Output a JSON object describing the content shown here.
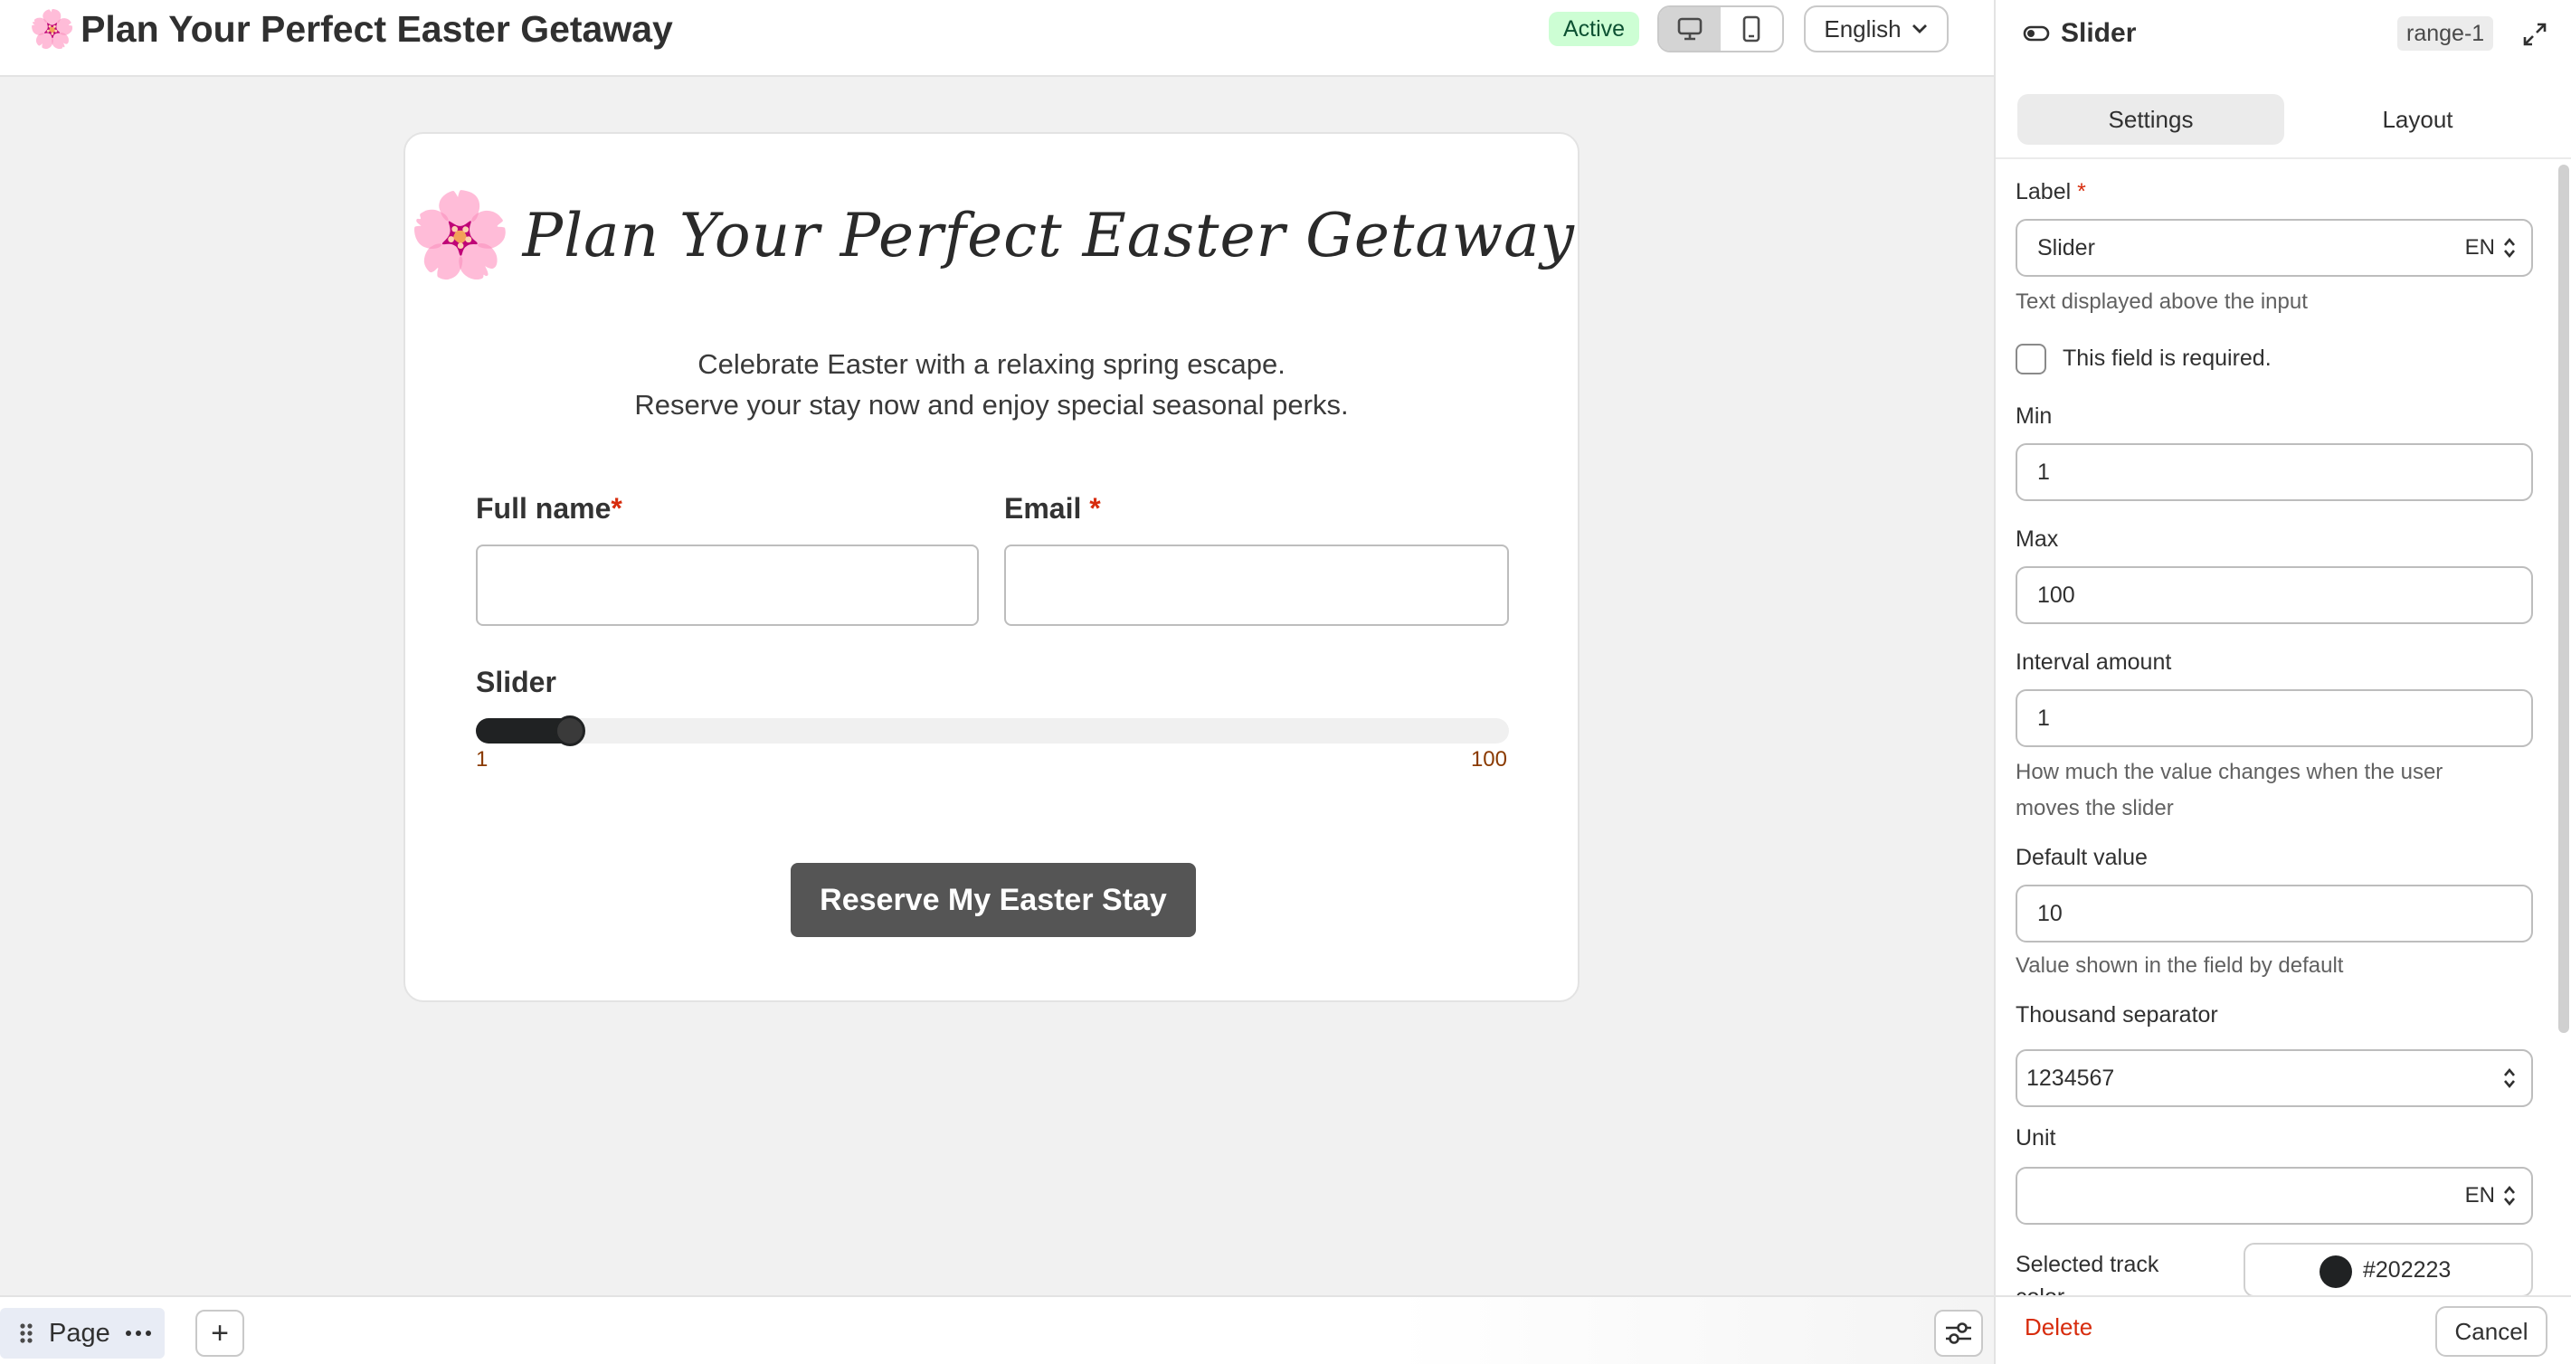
{
  "header": {
    "emoji": "🌸",
    "title": "Plan Your Perfect Easter Getaway",
    "status": "Active",
    "language": "English"
  },
  "form": {
    "emoji": "🌸",
    "heading": "Plan Your Perfect Easter Getaway",
    "subtitle_line1": "Celebrate Easter with a relaxing spring escape.",
    "subtitle_line2": "Reserve your stay now and enjoy special seasonal perks.",
    "full_name_label": "Full name",
    "email_label": "Email",
    "required_mark": "*",
    "slider_label": "Slider",
    "slider_min": "1",
    "slider_max": "100",
    "slider_value": 10,
    "submit_label": "Reserve My Easter Stay"
  },
  "bottombar": {
    "page_label": "Page",
    "add_label": "+"
  },
  "panel": {
    "title": "Slider",
    "element_id": "range-1",
    "tabs": [
      "Settings",
      "Layout"
    ],
    "label_field_label": "Label",
    "required_mark": "*",
    "label_value": "Slider",
    "lang_code": "EN",
    "label_help": "Text displayed above the input",
    "required_checkbox_label": "This field is required.",
    "min_label": "Min",
    "min_value": "1",
    "max_label": "Max",
    "max_value": "100",
    "interval_label": "Interval amount",
    "interval_value": "1",
    "interval_help_line1": "How much the value changes when the user",
    "interval_help_line2": "moves the slider",
    "default_label": "Default value",
    "default_value": "10",
    "default_help": "Value shown in the field by default",
    "thousand_label": "Thousand separator",
    "thousand_value": "1234567",
    "unit_label": "Unit",
    "unit_value": "",
    "track_color_label_line1": "Selected track",
    "track_color_label_line2": "color",
    "track_color_value": "#202223",
    "delete_label": "Delete",
    "cancel_label": "Cancel"
  },
  "colors": {
    "accent_dark": "#202223",
    "status_bg": "#cdfed4",
    "danger": "#d72c0d"
  }
}
